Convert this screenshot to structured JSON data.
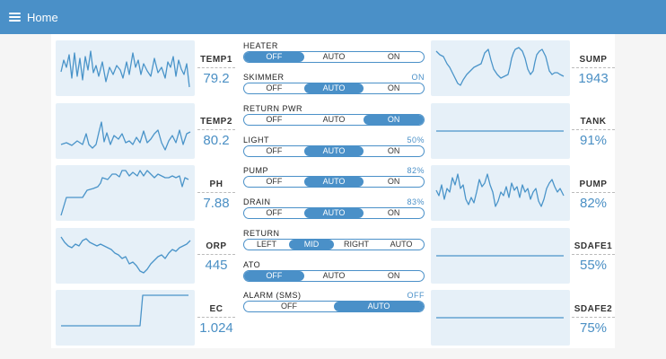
{
  "header": {
    "title": "Home"
  },
  "left_metrics": [
    {
      "label": "TEMP1",
      "value": "79.2"
    },
    {
      "label": "TEMP2",
      "value": "80.2"
    },
    {
      "label": "PH",
      "value": "7.88"
    },
    {
      "label": "ORP",
      "value": "445"
    },
    {
      "label": "EC",
      "value": "1.024"
    }
  ],
  "right_metrics": [
    {
      "label": "SUMP",
      "value": "1943"
    },
    {
      "label": "TANK",
      "value": "91%"
    },
    {
      "label": "PUMP",
      "value": "82%"
    },
    {
      "label": "SDAFE1",
      "value": "55%"
    },
    {
      "label": "SDAFE2",
      "value": "75%"
    }
  ],
  "controls": [
    {
      "label": "HEATER",
      "status": "",
      "options": [
        "OFF",
        "AUTO",
        "ON"
      ],
      "selected": 0
    },
    {
      "label": "SKIMMER",
      "status": "ON",
      "options": [
        "OFF",
        "AUTO",
        "ON"
      ],
      "selected": 1
    },
    {
      "label": "RETURN PWR",
      "status": "",
      "options": [
        "OFF",
        "AUTO",
        "ON"
      ],
      "selected": 2
    },
    {
      "label": "LIGHT",
      "status": "50%",
      "options": [
        "OFF",
        "AUTO",
        "ON"
      ],
      "selected": 1
    },
    {
      "label": "PUMP",
      "status": "82%",
      "options": [
        "OFF",
        "AUTO",
        "ON"
      ],
      "selected": 1
    },
    {
      "label": "DRAIN",
      "status": "83%",
      "options": [
        "OFF",
        "AUTO",
        "ON"
      ],
      "selected": 1
    },
    {
      "label": "RETURN",
      "status": "",
      "options": [
        "LEFT",
        "MID",
        "RIGHT",
        "AUTO"
      ],
      "selected": 1
    },
    {
      "label": "ATO",
      "status": "",
      "options": [
        "OFF",
        "AUTO",
        "ON"
      ],
      "selected": 0
    },
    {
      "label": "ALARM (SMS)",
      "status": "OFF",
      "options": [
        "OFF",
        "AUTO"
      ],
      "selected": 1
    }
  ],
  "colors": {
    "accent": "#4a90c8",
    "chart_bg": "#e6f0f8",
    "header_bg": "#4a90c8"
  },
  "icons": {
    "menu": "hamburger-menu-icon"
  }
}
